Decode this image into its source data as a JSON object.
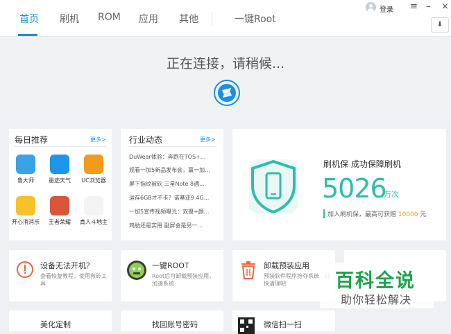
{
  "nav": {
    "tabs": [
      {
        "label": "首页"
      },
      {
        "label": "刷机"
      },
      {
        "label": "ROM"
      },
      {
        "label": "应用"
      },
      {
        "label": "其他"
      },
      {
        "label": "一键Root"
      }
    ],
    "active": "首页"
  },
  "window": {
    "login_label": "登录",
    "menu_icon": "≡",
    "minimize_icon": "–",
    "close_icon": "×",
    "download_icon": "⬇"
  },
  "status": {
    "text": "正在连接，请稍候..."
  },
  "daily": {
    "title": "每日推荐",
    "more": "更多>",
    "apps": [
      {
        "label": "鲁大师",
        "color": "#3aa3e6"
      },
      {
        "label": "墨迹天气",
        "color": "#1e96e8"
      },
      {
        "label": "UC浏览器",
        "color": "#f29a19"
      },
      {
        "label": "开心消消乐",
        "color": "#f6c22a"
      },
      {
        "label": "王者荣耀",
        "color": "#d9553c"
      },
      {
        "label": "真人斗地主",
        "color": "#f4f4f4"
      }
    ]
  },
  "news": {
    "title": "行业动态",
    "more": "更多>",
    "items": [
      "DuWear体验：奔跑在TOS+...",
      "观看一加5新品发布会，赢一加...",
      "屏下指纹被砍 三星Note 8遇...",
      "运存6GB才不卡？诺基亚9 4G...",
      "一加5宣传视频曝光：双摄+颜...",
      "鸡肋还是实用 副屏会是另一..."
    ]
  },
  "promo": {
    "title": "刷机保  成功保障刷机",
    "count": "5026",
    "unit": "万次",
    "note_prefix": "加入刷机保，最高可获赔 ",
    "note_amount": "10000",
    "note_suffix": " 元",
    "accent": "#2bbfa7"
  },
  "tools": [
    {
      "title": "设备无法开机？",
      "desc": "查看恢复教程，使用救砖工具"
    },
    {
      "title": "一键ROOT",
      "desc": "Root后可卸载预装应用，加速系统"
    },
    {
      "title": "卸载预装应用",
      "desc": "预装软件程序抢夺系统，赶快清理吧"
    }
  ],
  "bottom_row": [
    {
      "title": "美化定制"
    },
    {
      "title": "找回账号密码"
    },
    {
      "title": "微信扫一扫"
    }
  ],
  "watermark": {
    "big": "百科全说",
    "small": "助你轻松解决"
  },
  "colors": {
    "brand": "#1a8fe3",
    "accent": "#2bbfa7",
    "warning": "#e8663d"
  }
}
